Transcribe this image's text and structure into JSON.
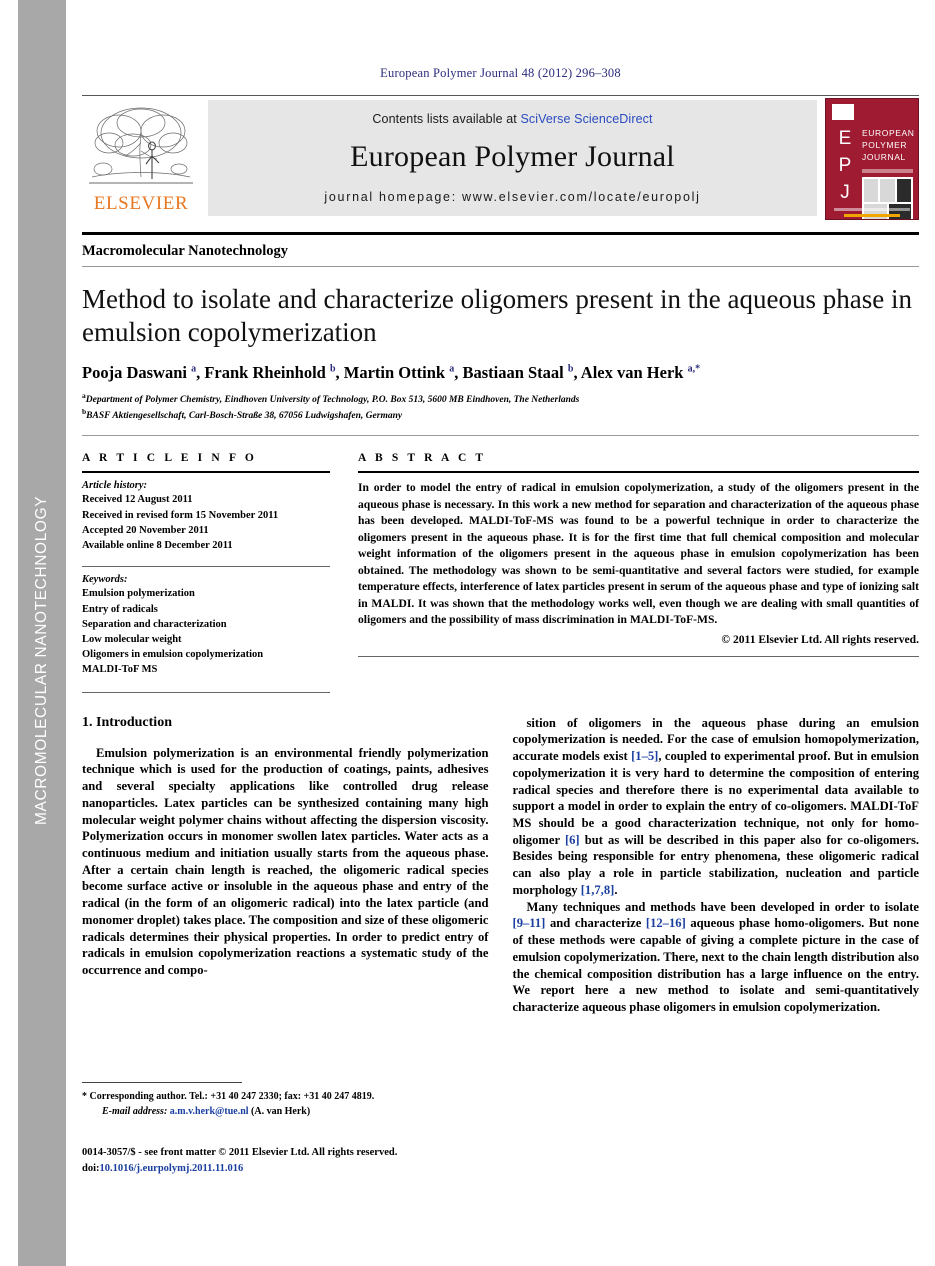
{
  "sidebar": {
    "label": "MACROMOLECULAR NANOTECHNOLOGY"
  },
  "running_head": "European Polymer Journal 48 (2012) 296–308",
  "masthead": {
    "publisher_name": "ELSEVIER",
    "contents_prefix": "Contents lists available at ",
    "contents_link": "SciVerse ScienceDirect",
    "journal_name": "European Polymer Journal",
    "homepage": "journal homepage: www.elsevier.com/locate/europolj",
    "cover": {
      "letters": [
        "E",
        "P",
        "J"
      ],
      "title_lines": [
        "EUROPEAN",
        "POLYMER",
        "JOURNAL"
      ],
      "accent_color": "#9e1b32"
    }
  },
  "section_label": "Macromolecular Nanotechnology",
  "article": {
    "title": "Method to isolate and characterize oligomers present in the aqueous phase in emulsion copolymerization",
    "authors_html": "Pooja Daswani <sup>a</sup>, Frank Rheinhold <sup>b</sup>, Martin Ottink <sup>a</sup>, Bastiaan Staal <sup>b</sup>, Alex van Herk <sup>a,</sup><sup>*</sup>",
    "affiliations": [
      "a Department of Polymer Chemistry, Eindhoven University of Technology, P.O. Box 513, 5600 MB Eindhoven, The Netherlands",
      "b BASF Aktiengesellschaft, Carl-Bosch-Straße 38, 67056 Ludwigshafen, Germany"
    ]
  },
  "article_info": {
    "heading": "A R T I C L E    I N F O",
    "history_heading": "Article history:",
    "history": [
      "Received 12 August 2011",
      "Received in revised form 15 November 2011",
      "Accepted 20 November 2011",
      "Available online 8 December 2011"
    ],
    "keywords_heading": "Keywords:",
    "keywords": [
      "Emulsion polymerization",
      "Entry of radicals",
      "Separation and characterization",
      "Low molecular weight",
      "Oligomers in emulsion copolymerization",
      "MALDI-ToF MS"
    ]
  },
  "abstract": {
    "heading": "A B S T R A C T",
    "text": "In order to model the entry of radical in emulsion copolymerization, a study of the oligomers present in the aqueous phase is necessary. In this work a new method for separation and characterization of the aqueous phase has been developed. MALDI-ToF-MS was found to be a powerful technique in order to characterize the oligomers present in the aqueous phase. It is for the first time that full chemical composition and molecular weight information of the oligomers present in the aqueous phase in emulsion copolymerization has been obtained. The methodology was shown to be semi-quantitative and several factors were studied, for example temperature effects, interference of latex particles present in serum of the aqueous phase and type of ionizing salt in MALDI. It was shown that the methodology works well, even though we are dealing with small quantities of oligomers and the possibility of mass discrimination in MALDI-ToF-MS.",
    "copyright": "© 2011 Elsevier Ltd. All rights reserved."
  },
  "body": {
    "section_heading": "1. Introduction",
    "left_paragraphs": [
      "Emulsion polymerization is an environmental friendly polymerization technique which is used for the production of coatings, paints, adhesives and several specialty applications like controlled drug release nanoparticles. Latex particles can be synthesized containing many high molecular weight polymer chains without affecting the dispersion viscosity. Polymerization occurs in monomer swollen latex particles. Water acts as a continuous medium and initiation usually starts from the aqueous phase. After a certain chain length is reached, the oligomeric radical species become surface active or insoluble in the aqueous phase and entry of the radical (in the form of an oligomeric radical) into the latex particle (and monomer droplet) takes place. The composition and size of these oligomeric radicals determines their physical properties. In order to predict entry of radicals in emulsion copolymerization reactions a systematic study of the occurrence and compo-"
    ],
    "right_paragraphs_html": [
      "sition of oligomers in the aqueous phase during an emulsion copolymerization is needed. For the case of emulsion homopolymerization, accurate models exist <span class=\"ref\">[1–5]</span>, coupled to experimental proof. But in emulsion copolymerization it is very hard to determine the composition of entering radical species and therefore there is no experimental data available to support a model in order to explain the entry of co-oligomers. MALDI-ToF MS should be a good characterization technique, not only for homo-oligomer <span class=\"ref\">[6]</span> but as will be described in this paper also for co-oligomers. Besides being responsible for entry phenomena, these oligomeric radical can also play a role in particle stabilization, nucleation and particle morphology <span class=\"ref\">[1,7,8]</span>.",
      "Many techniques and methods have been developed in order to isolate <span class=\"ref\">[9–11]</span> and characterize <span class=\"ref\">[12–16]</span> aqueous phase homo-oligomers. But none of these methods were capable of giving a complete picture in the case of emulsion copolymerization. There, next to the chain length distribution also the chemical composition distribution has a large influence on the entry. We report here a new method to isolate and semi-quantitatively characterize aqueous phase oligomers in emulsion copolymerization."
    ]
  },
  "footnotes": {
    "corresponding_symbol": "*",
    "corresponding_text": "Corresponding author. Tel.: +31 40 247 2330; fax: +31 40 247 4819.",
    "email_label": "E-mail address:",
    "email": "a.m.v.herk@tue.nl",
    "email_owner": "(A. van Herk)"
  },
  "footer": {
    "issn_line": "0014-3057/$ - see front matter © 2011 Elsevier Ltd. All rights reserved.",
    "doi_prefix": "doi:",
    "doi": "10.1016/j.eurpolymj.2011.11.016"
  }
}
